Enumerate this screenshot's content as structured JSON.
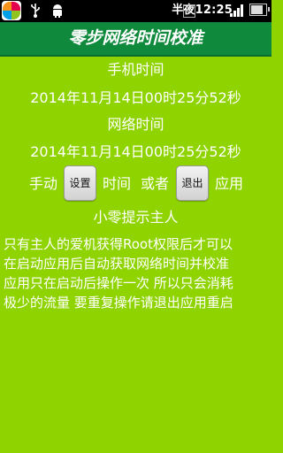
{
  "status_bar": {
    "time": "半夜12:25",
    "icons": [
      "app-icon",
      "usb-icon",
      "android-icon",
      "data-e-icon",
      "signal-icon",
      "battery-icon"
    ],
    "network_type": "E"
  },
  "header": {
    "title": "零步网络时间校准"
  },
  "phone_time": {
    "label": "手机时间",
    "value": "2014年11月14日00时25分52秒"
  },
  "network_time": {
    "label": "网络时间",
    "value": "2014年11月14日00时25分52秒"
  },
  "actions": {
    "prefix": "手动",
    "settings_button": "设置",
    "time_label": "时间",
    "or_label": "或者",
    "exit_button": "退出",
    "apply_label": "应用"
  },
  "tips": {
    "heading": "小零提示主人",
    "lines": [
      "只有主人的爱机获得Root权限后才可以",
      "在启动应用后自动获取网络时间并校准",
      "应用只在启动后操作一次 所以只会消耗",
      "极少的流量 要重复操作请退出应用重启"
    ]
  },
  "colors": {
    "background": "#8fd400",
    "titlebar": "#0f8a3c",
    "text": "#ffffff"
  }
}
